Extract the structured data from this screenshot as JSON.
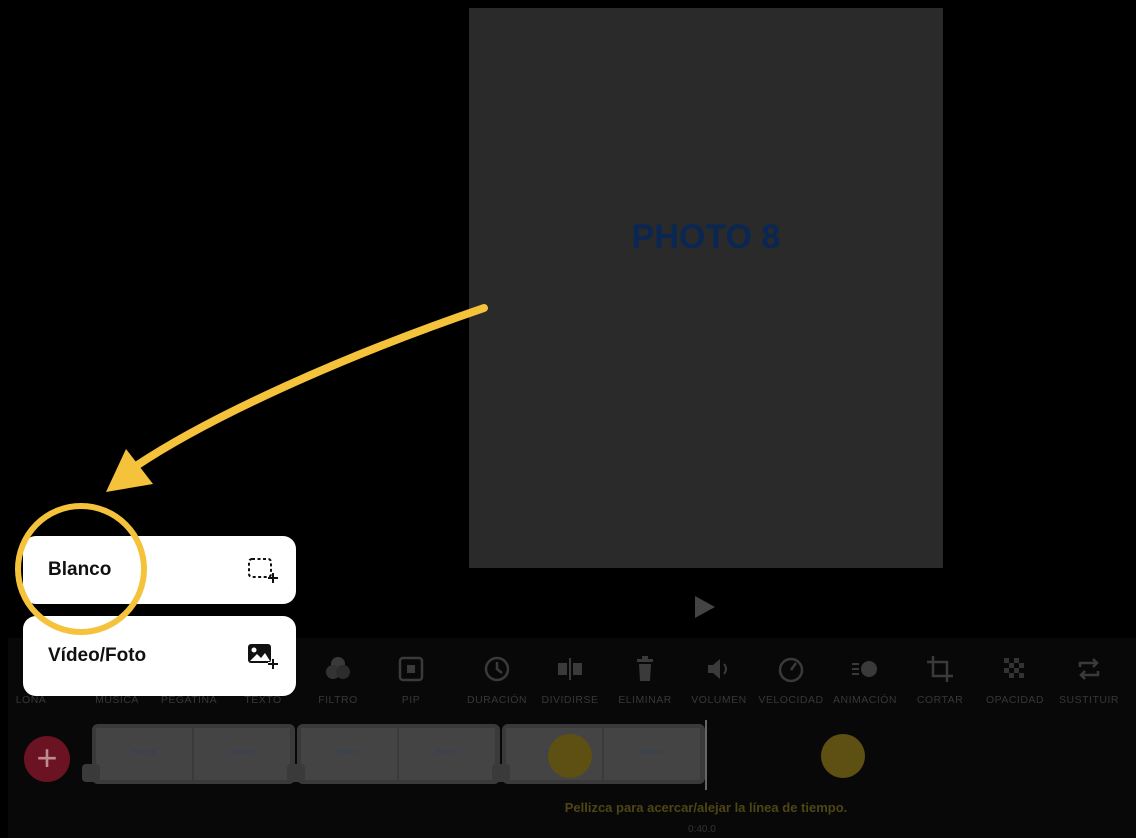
{
  "preview": {
    "title": "PHOTO 8"
  },
  "toolbar": {
    "tools": [
      {
        "label": "LONA"
      },
      {
        "label": "MÚSICA"
      },
      {
        "label": "PEGATINA"
      },
      {
        "label": "TEXTO"
      },
      {
        "label": "FILTRO"
      },
      {
        "label": "PIP"
      },
      {
        "label": "DURACIÓN"
      },
      {
        "label": "DIVIDIRSE"
      },
      {
        "label": "ELIMINAR"
      },
      {
        "label": "VOLUMEN"
      },
      {
        "label": "VELOCIDAD"
      },
      {
        "label": "ANIMACIÓN"
      },
      {
        "label": "CORTAR"
      },
      {
        "label": "OPACIDAD"
      },
      {
        "label": "SUSTITUIR"
      }
    ]
  },
  "timeline": {
    "add_label": "+",
    "clips": [
      {
        "thumbs": [
          "PHOTO 8",
          "PHOTO 8",
          "PHOTO 8"
        ]
      },
      {
        "thumbs": [
          "PHOTO 7",
          "PHOTO 7",
          "PHOTO 7"
        ]
      },
      {
        "thumbs": [
          "PHOTO 6",
          "PHOTO 6",
          "PHOTO 6"
        ]
      }
    ],
    "hint": "Pellizca para acercar/alejar la línea de tiempo.",
    "timecode": "0:40.0"
  },
  "menu": {
    "items": [
      {
        "label": "Blanco",
        "icon": "blank-frame-add-icon"
      },
      {
        "label": "Vídeo/Foto",
        "icon": "photo-add-icon"
      }
    ]
  },
  "colors": {
    "highlight": "#f5c33b",
    "menu_bg": "#ffffff",
    "overlay": "#000000"
  }
}
